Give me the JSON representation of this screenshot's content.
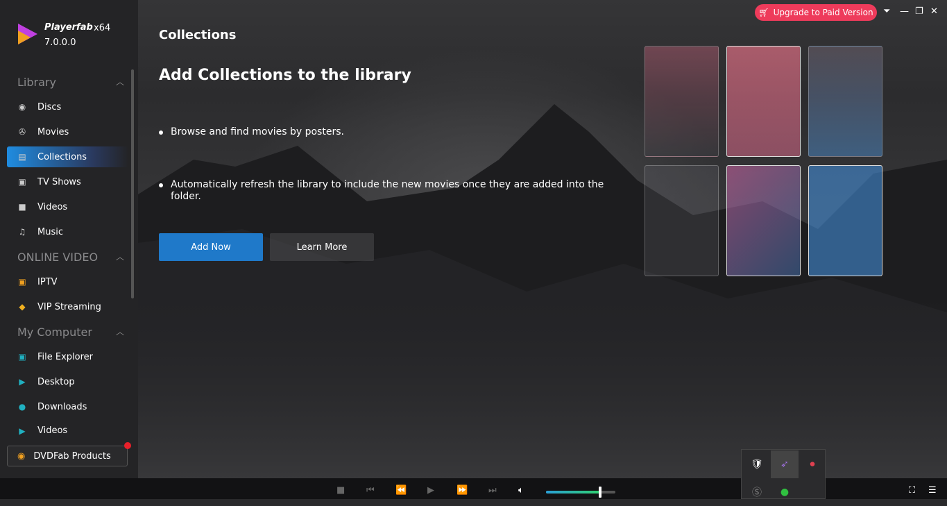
{
  "app": {
    "name": "Playerfab",
    "arch": "x64",
    "version": "7.0.0.0"
  },
  "sidebar": {
    "sections": [
      {
        "label": "Library"
      },
      {
        "label": "ONLINE VIDEO"
      },
      {
        "label": "My Computer"
      }
    ],
    "library": [
      {
        "label": "Discs",
        "icon": "disc-icon"
      },
      {
        "label": "Movies",
        "icon": "film-reel-icon"
      },
      {
        "label": "Collections",
        "icon": "collections-icon",
        "active": true
      },
      {
        "label": "TV Shows",
        "icon": "tv-icon"
      },
      {
        "label": "Videos",
        "icon": "video-camera-icon"
      },
      {
        "label": "Music",
        "icon": "music-note-icon"
      }
    ],
    "online": [
      {
        "label": "IPTV",
        "icon": "iptv-icon"
      },
      {
        "label": "VIP Streaming",
        "icon": "vip-diamond-icon"
      }
    ],
    "computer": [
      {
        "label": "File Explorer",
        "icon": "file-explorer-icon"
      },
      {
        "label": "Desktop",
        "icon": "desktop-icon"
      },
      {
        "label": "Downloads",
        "icon": "downloads-icon"
      },
      {
        "label": "Videos",
        "icon": "videos-folder-icon"
      }
    ],
    "products": "DVDFab Products"
  },
  "main": {
    "title": "Collections",
    "heading": "Add Collections to the library",
    "bullets": [
      "Browse and find movies by posters.",
      "Automatically refresh the library to include the new movies once they are added into the folder."
    ],
    "add_now": "Add Now",
    "learn_more": "Learn More"
  },
  "titlebar": {
    "upgrade": "Upgrade to Paid Version"
  },
  "player": {
    "volume_percent": 78
  },
  "colors": {
    "accent": "#1f79c9",
    "upgrade": "#ee3b5b"
  }
}
